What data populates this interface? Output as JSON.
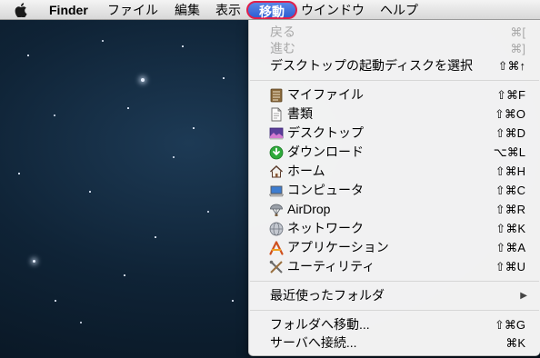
{
  "menubar": {
    "apple_icon": "apple-logo-icon",
    "finder": "Finder",
    "file": "ファイル",
    "edit": "編集",
    "view": "表示",
    "go": "移動",
    "window": "ウインドウ",
    "help": "ヘルプ"
  },
  "go_menu": {
    "back": {
      "label": "戻る",
      "shortcut": "⌘["
    },
    "forward": {
      "label": "進む",
      "shortcut": "⌘]"
    },
    "startup_disk": {
      "label": "デスクトップの起動ディスクを選択",
      "shortcut": "⇧⌘↑"
    },
    "all_my_files": {
      "label": "マイファイル",
      "shortcut": "⇧⌘F",
      "icon": "all-my-files-icon"
    },
    "documents": {
      "label": "書類",
      "shortcut": "⇧⌘O",
      "icon": "documents-icon"
    },
    "desktop": {
      "label": "デスクトップ",
      "shortcut": "⇧⌘D",
      "icon": "desktop-icon"
    },
    "downloads": {
      "label": "ダウンロード",
      "shortcut": "⌥⌘L",
      "icon": "downloads-icon"
    },
    "home": {
      "label": "ホーム",
      "shortcut": "⇧⌘H",
      "icon": "home-icon"
    },
    "computer": {
      "label": "コンピュータ",
      "shortcut": "⇧⌘C",
      "icon": "computer-icon"
    },
    "airdrop": {
      "label": "AirDrop",
      "shortcut": "⇧⌘R",
      "icon": "airdrop-icon"
    },
    "network": {
      "label": "ネットワーク",
      "shortcut": "⇧⌘K",
      "icon": "network-icon"
    },
    "applications": {
      "label": "アプリケーション",
      "shortcut": "⇧⌘A",
      "icon": "applications-icon"
    },
    "utilities": {
      "label": "ユーティリティ",
      "shortcut": "⇧⌘U",
      "icon": "utilities-icon"
    },
    "recent_folders": {
      "label": "最近使ったフォルダ",
      "submenu_icon": "submenu-arrow-icon"
    },
    "go_to_folder": {
      "label": "フォルダへ移動...",
      "shortcut": "⇧⌘G"
    },
    "connect_to_server": {
      "label": "サーバへ接続...",
      "shortcut": "⌘K"
    }
  },
  "colors": {
    "menu_highlight": "#3b6ad8",
    "annotation_outline": "#e0204a",
    "disabled_text": "#a8a8a8"
  }
}
